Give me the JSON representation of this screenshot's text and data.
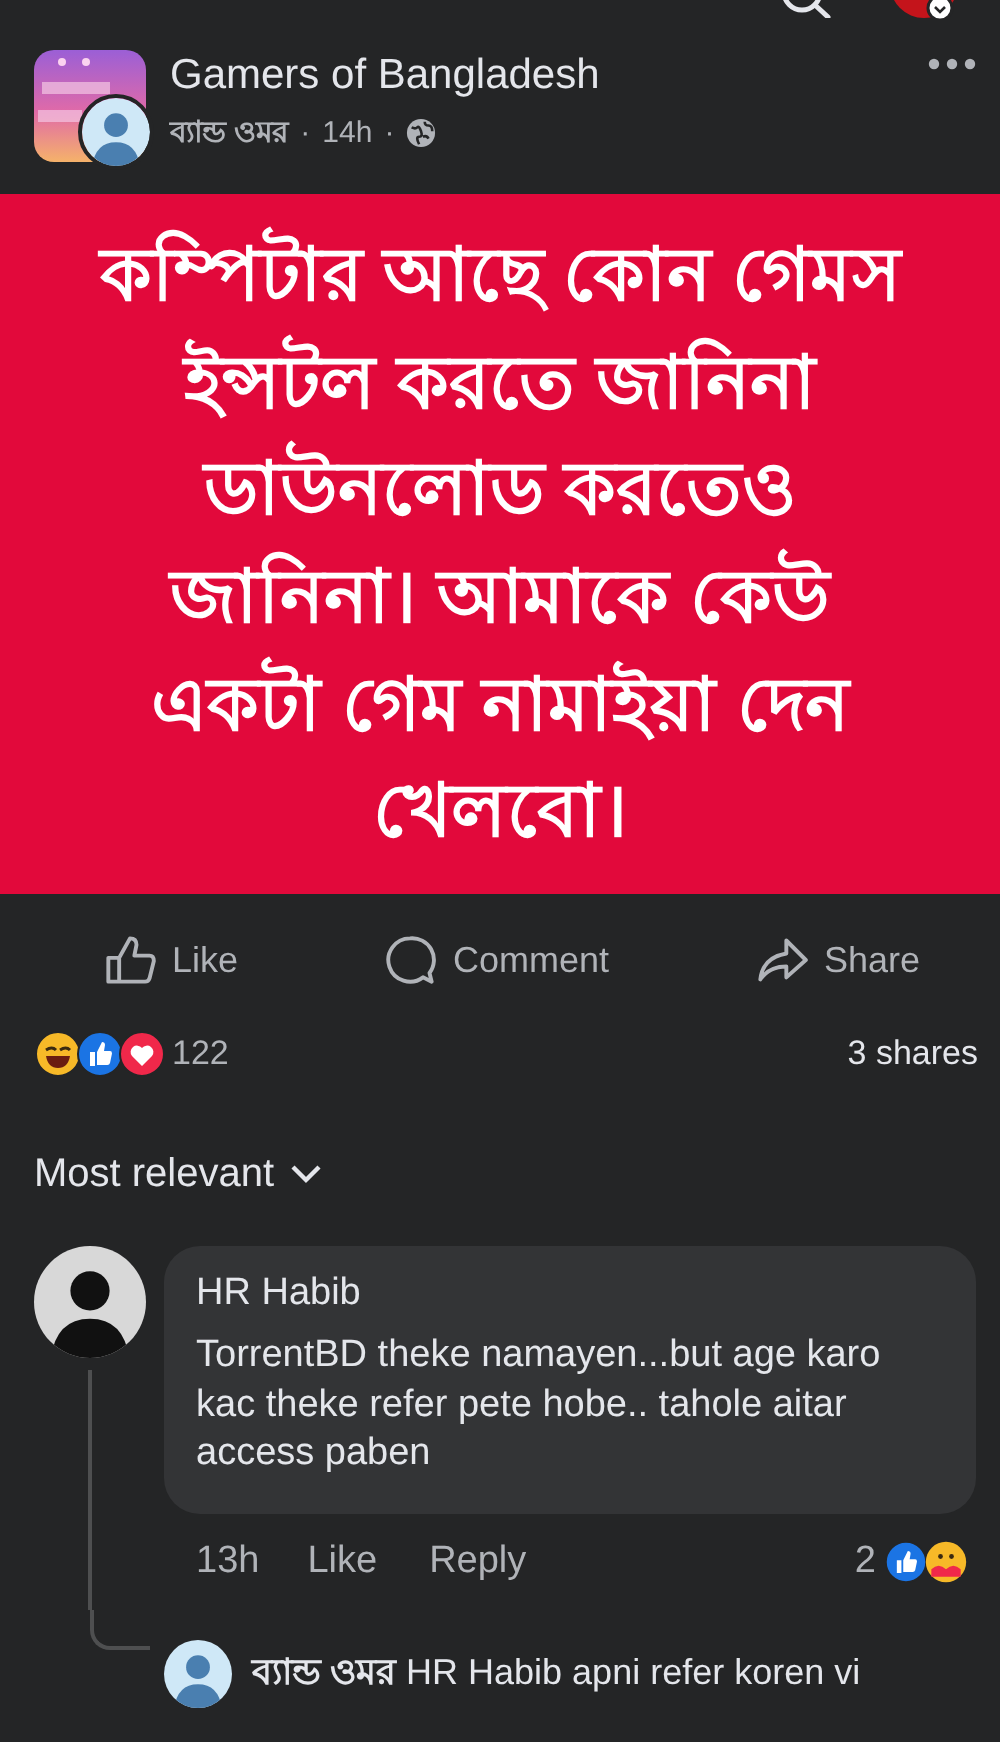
{
  "group": {
    "name": "Gamers of Bangladesh",
    "author": "ব্যান্ড ওমর",
    "separator": "·",
    "time": "14h"
  },
  "post": {
    "text": "কম্পিটার আছে কোন গেমস ইন্সটল করতে জানিনা ডাউনলোড করতেও জানিনা। আমাকে কেউ একটা গেম নামাইয়া দেন খেলবো।"
  },
  "actions": [
    {
      "kind": "like",
      "label": "Like"
    },
    {
      "kind": "comment",
      "label": "Comment"
    },
    {
      "kind": "share",
      "label": "Share"
    }
  ],
  "reactions": {
    "count": "122",
    "shares": "3 shares"
  },
  "sort": {
    "label": "Most relevant"
  },
  "comments": [
    {
      "author": "HR Habib",
      "text": "TorrentBD theke namayen...but age karo kac theke refer pete hobe.. tahole aitar access paben",
      "time": "13h",
      "actions": [
        "Like",
        "Reply"
      ],
      "reaction_count": "2"
    }
  ],
  "reply": {
    "author": "ব্যান্ড ওমর",
    "text": "HR Habib apni refer koren vi"
  }
}
